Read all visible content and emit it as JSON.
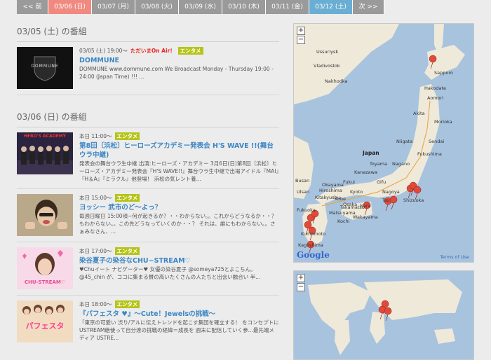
{
  "date_tabs": {
    "prev": "<< 前",
    "days": [
      "03/06 (日)",
      "03/07 (月)",
      "03/08 (火)",
      "03/09 (水)",
      "03/10 (木)",
      "03/11 (金)",
      "03/12 (土)"
    ],
    "next": "次 >>"
  },
  "sections": [
    {
      "heading": "03/05 (土) の番組",
      "entries": [
        {
          "time": "03/05 (土) 19:00～",
          "onair": "ただいまOn Air！",
          "badge": "エンタメ",
          "title": "DOMMUNE",
          "desc": "DOMMUNE www.dommune.com We Broadcast Monday - Thursday 19:00 - 24:00 (Japan Time) !!! ...",
          "thumb_text": "DOMMUNE"
        }
      ]
    },
    {
      "heading": "03/06 (日) の番組",
      "entries": [
        {
          "time": "本日 11:00～",
          "badge": "エンタメ",
          "title": "第8回〔浜松〕ヒーローズアカデミー発表会 H'S WAVE !!(舞台ウラ中継)",
          "desc": "発表会の舞台ウラ生中継 出演:ヒーローズ・アカデミー 3月6日(日)第8回〔浜松〕ヒーローズ・アカデミー発表会『H'S WAVE!!』舞台ウラ生中継で出場アイドル『MAI』『H＆A』『ミラクル』他登場！ 浜松の気レント養...",
          "thumb_text": "HERO'S ACADEMY"
        },
        {
          "time": "本日 15:00～",
          "badge": "エンタメ",
          "title": "ヨッシー 武市のど～よっ？",
          "desc": "毎週日曜日 15:00頃~何が起きるか？・・わからない。。これからどうなるか・・？ もわからない。。この先どうなっていくのか・・？ それは、誰にもわからない。。さぁみなさん、..."
        },
        {
          "time": "本日 17:00～",
          "badge": "エンタメ",
          "title": "染谷夏子の染谷なCHU~STREAM♡",
          "desc": "♥Chuイート ナビゲーター♥ 女優の染谷夏子 @someya725とよこちん。@45_chin が、ココに集まる賛の高いたくさんの人たちと出会い触合い 半...",
          "thumb_text": "CHU-STREAM♡"
        },
        {
          "time": "本日 18:00～",
          "badge": "エンタメ",
          "title": "『パフェスタ ♥』～Cute！Jewelsの挑戦～",
          "desc": "「東京の可愛い 渋り/アルに伝えトレンドを起こす集団を確立する！ をコンセプトにUSTREAM絶使って自分達の挑戦の経緯＝成長を 週末に配信していく参...最先端メディア USTRE...",
          "thumb_text": "パフェスタ"
        }
      ]
    }
  ],
  "japan_map": {
    "labels": [
      "Ussuriysk",
      "Vladivostok",
      "Nakhodka",
      "Sapporo",
      "Hakodate",
      "Aomori",
      "Akita",
      "Morioka",
      "Sendai",
      "Fukushima",
      "Japan",
      "Niigata",
      "Nagano",
      "Toyama",
      "Kanazawa",
      "Fukui",
      "Gifu",
      "Nagoya",
      "Shizuoka",
      "Tsu",
      "Nara",
      "Kyoto",
      "Osaka",
      "Wakayama",
      "Kobe",
      "Okayama",
      "Hiroshima",
      "Matsuyama",
      "Takamatsu",
      "Kochi",
      "Kitakyushu",
      "Fukuoka",
      "Kumamoto",
      "Kagoshima",
      "Busan",
      "Ulsan"
    ],
    "google": "Google",
    "terms": "Terms of Use",
    "zoom_in": "+",
    "zoom_out": "−"
  },
  "world_map": {
    "google": "Google",
    "zoom_in": "+",
    "zoom_out": "−"
  }
}
